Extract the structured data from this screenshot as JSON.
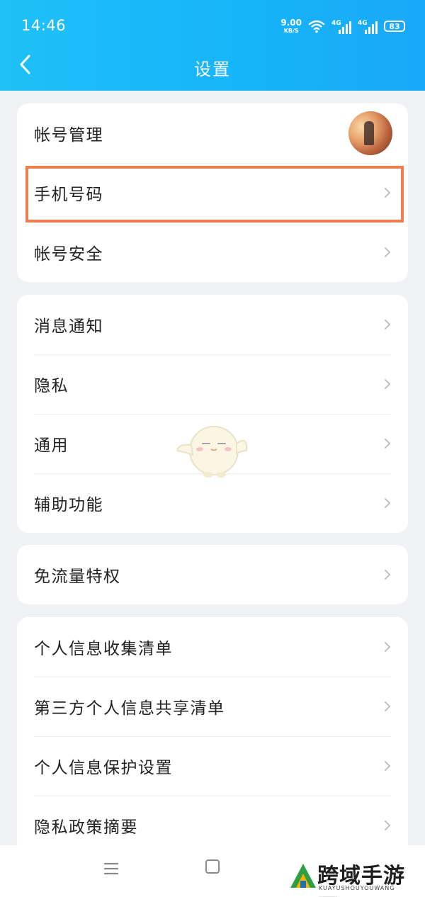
{
  "status_bar": {
    "time": "14:46",
    "net_speed_value": "9.00",
    "net_speed_unit": "KB/S",
    "sim1_label": "4G",
    "sim2_label": "4G",
    "battery": "83",
    "icons": [
      "wifi-icon",
      "signal-icon",
      "signal-icon",
      "battery-icon"
    ]
  },
  "nav": {
    "title": "设置",
    "back_icon": "chevron-left-icon"
  },
  "groups": [
    {
      "items": [
        {
          "label": "帐号管理",
          "trailing": "avatar"
        },
        {
          "label": "手机号码",
          "trailing": "chevron-right-icon",
          "highlighted": true
        },
        {
          "label": "帐号安全",
          "trailing": "chevron-right-icon"
        }
      ]
    },
    {
      "items": [
        {
          "label": "消息通知",
          "trailing": "chevron-right-icon"
        },
        {
          "label": "隐私",
          "trailing": "chevron-right-icon"
        },
        {
          "label": "通用",
          "trailing": "chevron-right-icon"
        },
        {
          "label": "辅助功能",
          "trailing": "chevron-right-icon"
        }
      ]
    },
    {
      "items": [
        {
          "label": "免流量特权",
          "trailing": "chevron-right-icon"
        }
      ]
    },
    {
      "items": [
        {
          "label": "个人信息收集清单",
          "trailing": "chevron-right-icon"
        },
        {
          "label": "第三方个人信息共享清单",
          "trailing": "chevron-right-icon"
        },
        {
          "label": "个人信息保护设置",
          "trailing": "chevron-right-icon"
        },
        {
          "label": "隐私政策摘要",
          "trailing": "chevron-right-icon"
        }
      ]
    }
  ],
  "bottom_nav": {
    "icons": [
      "menu-icon",
      "home-icon"
    ]
  },
  "watermark": {
    "text": "跨域手游网",
    "sub": "KUAYUSHOUYOUWANG"
  },
  "colors": {
    "header_start": "#1fc0f7",
    "header_end": "#1aa8f8",
    "highlight_border": "#ee7d4f",
    "background": "#f1f2f6"
  }
}
